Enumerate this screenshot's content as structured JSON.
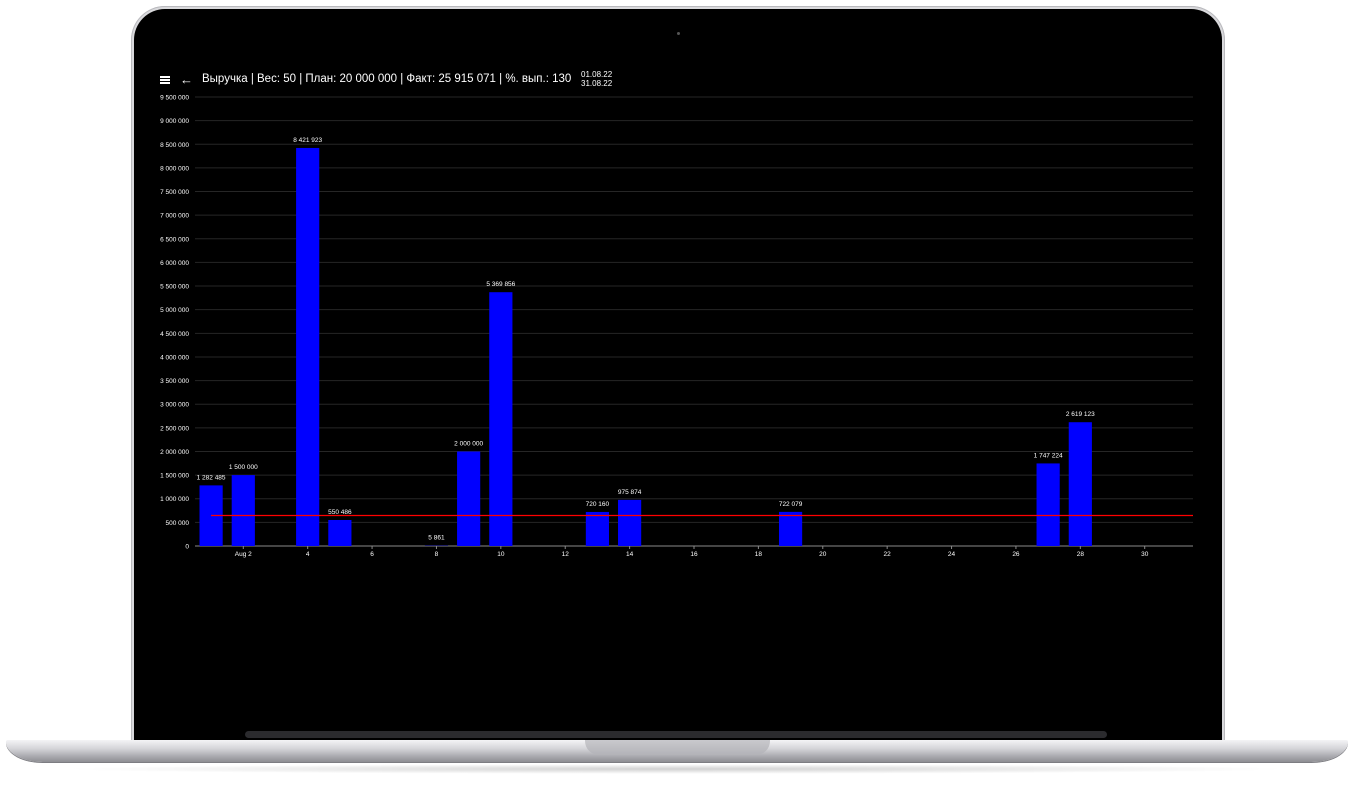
{
  "header": {
    "title": "Выручка | Вес: 50 | План: 20 000 000 | Факт: 25 915 071 | %. вып.: 130",
    "date_from": "01.08.22",
    "date_to": "31.08.22",
    "menu_icon": "hamburger-menu-icon",
    "back_icon": "arrow-back-icon"
  },
  "colors": {
    "bar": "#0000ff",
    "plan_line": "#ff0000",
    "background": "#000000",
    "grid": "#262626",
    "text": "#ffffff"
  },
  "chart_data": {
    "type": "bar",
    "title": "",
    "xlabel": "",
    "ylabel": "",
    "x_type": "date",
    "xlim": [
      "2022-08-01",
      "2022-08-31"
    ],
    "ylim": [
      0,
      9500000
    ],
    "y_ticks": [
      {
        "value": 0,
        "label": "0"
      },
      {
        "value": 500000,
        "label": "500 000"
      },
      {
        "value": 1000000,
        "label": "1 000 000"
      },
      {
        "value": 1500000,
        "label": "1 500 000"
      },
      {
        "value": 2000000,
        "label": "2 000 000"
      },
      {
        "value": 2500000,
        "label": "2 500 000"
      },
      {
        "value": 3000000,
        "label": "3 000 000"
      },
      {
        "value": 3500000,
        "label": "3 500 000"
      },
      {
        "value": 4000000,
        "label": "4 000 000"
      },
      {
        "value": 4500000,
        "label": "4 500 000"
      },
      {
        "value": 5000000,
        "label": "5 000 000"
      },
      {
        "value": 5500000,
        "label": "5 500 000"
      },
      {
        "value": 6000000,
        "label": "6 000 000"
      },
      {
        "value": 6500000,
        "label": "6 500 000"
      },
      {
        "value": 7000000,
        "label": "7 000 000"
      },
      {
        "value": 7500000,
        "label": "7 500 000"
      },
      {
        "value": 8000000,
        "label": "8 000 000"
      },
      {
        "value": 8500000,
        "label": "8 500 000"
      },
      {
        "value": 9000000,
        "label": "9 000 000"
      },
      {
        "value": 9500000,
        "label": "9 500 000"
      }
    ],
    "x_ticks": [
      {
        "value": "2022-08-02",
        "label": "Aug 2"
      },
      {
        "value": "2022-08-04",
        "label": "4"
      },
      {
        "value": "2022-08-06",
        "label": "6"
      },
      {
        "value": "2022-08-08",
        "label": "8"
      },
      {
        "value": "2022-08-10",
        "label": "10"
      },
      {
        "value": "2022-08-12",
        "label": "12"
      },
      {
        "value": "2022-08-14",
        "label": "14"
      },
      {
        "value": "2022-08-16",
        "label": "16"
      },
      {
        "value": "2022-08-18",
        "label": "18"
      },
      {
        "value": "2022-08-20",
        "label": "20"
      },
      {
        "value": "2022-08-22",
        "label": "22"
      },
      {
        "value": "2022-08-24",
        "label": "24"
      },
      {
        "value": "2022-08-26",
        "label": "26"
      },
      {
        "value": "2022-08-28",
        "label": "28"
      },
      {
        "value": "2022-08-30",
        "label": "30"
      }
    ],
    "points": [
      {
        "x": "2022-08-01",
        "y": 1282485,
        "label": "1 282 485"
      },
      {
        "x": "2022-08-02",
        "y": 1500000,
        "label": "1 500 000"
      },
      {
        "x": "2022-08-04",
        "y": 8421923,
        "label": "8 421 923"
      },
      {
        "x": "2022-08-05",
        "y": 550486,
        "label": "550 486"
      },
      {
        "x": "2022-08-08",
        "y": 5861,
        "label": "5 861"
      },
      {
        "x": "2022-08-09",
        "y": 2000000,
        "label": "2 000 000"
      },
      {
        "x": "2022-08-10",
        "y": 5369856,
        "label": "5 369 856"
      },
      {
        "x": "2022-08-13",
        "y": 720160,
        "label": "720 160"
      },
      {
        "x": "2022-08-14",
        "y": 975874,
        "label": "975 874"
      },
      {
        "x": "2022-08-19",
        "y": 722079,
        "label": "722 079"
      },
      {
        "x": "2022-08-27",
        "y": 1747224,
        "label": "1 747 224"
      },
      {
        "x": "2022-08-28",
        "y": 2619123,
        "label": "2 619 123"
      }
    ],
    "reference_line": {
      "y": 645161
    },
    "grid": true,
    "legend": "none"
  }
}
